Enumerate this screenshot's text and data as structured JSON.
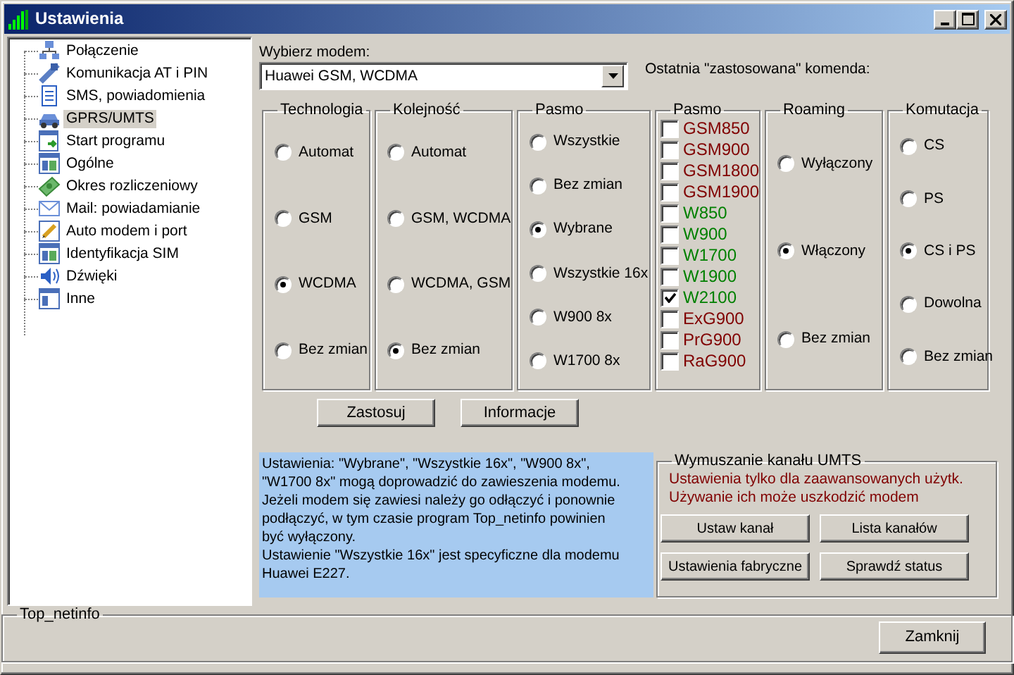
{
  "window": {
    "title": "Ustawienia"
  },
  "sidebar": {
    "items": [
      {
        "label": "Połączenie",
        "selected": false
      },
      {
        "label": "Komunikacja AT i PIN",
        "selected": false
      },
      {
        "label": "SMS, powiadomienia",
        "selected": false
      },
      {
        "label": "GPRS/UMTS",
        "selected": true
      },
      {
        "label": "Start programu",
        "selected": false
      },
      {
        "label": "Ogólne",
        "selected": false
      },
      {
        "label": "Okres rozliczeniowy",
        "selected": false
      },
      {
        "label": "Mail: powiadamianie",
        "selected": false
      },
      {
        "label": "Auto modem i port",
        "selected": false
      },
      {
        "label": "Identyfikacja SIM",
        "selected": false
      },
      {
        "label": "Dźwięki",
        "selected": false
      },
      {
        "label": "Inne",
        "selected": false
      }
    ]
  },
  "modem": {
    "label": "Wybierz modem:",
    "value": "Huawei GSM, WCDMA"
  },
  "last_command": {
    "label": "Ostatnia \"zastosowana\" komenda:"
  },
  "groups": [
    {
      "kind": "radio",
      "title": "Technologia",
      "options": [
        {
          "label": "Automat",
          "selected": false
        },
        {
          "label": "GSM",
          "selected": false
        },
        {
          "label": "WCDMA",
          "selected": true
        },
        {
          "label": "Bez zmian",
          "selected": false
        }
      ]
    },
    {
      "kind": "radio",
      "title": "Kolejność",
      "options": [
        {
          "label": "Automat",
          "selected": false
        },
        {
          "label": "GSM, WCDMA",
          "selected": false
        },
        {
          "label": "WCDMA, GSM",
          "selected": false
        },
        {
          "label": "Bez zmian",
          "selected": true
        }
      ]
    },
    {
      "kind": "radio",
      "title": "Pasmo",
      "options": [
        {
          "label": "Wszystkie",
          "selected": false
        },
        {
          "label": "Bez zmian",
          "selected": false
        },
        {
          "label": "Wybrane",
          "selected": true
        },
        {
          "label": "Wszystkie 16x",
          "selected": false
        },
        {
          "label": "W900 8x",
          "selected": false
        },
        {
          "label": "W1700 8x",
          "selected": false
        }
      ]
    },
    {
      "kind": "checkbox",
      "title": "Pasmo",
      "options": [
        {
          "label": "GSM850",
          "checked": false,
          "color": "#800000"
        },
        {
          "label": "GSM900",
          "checked": false,
          "color": "#800000"
        },
        {
          "label": "GSM1800",
          "checked": false,
          "color": "#800000"
        },
        {
          "label": "GSM1900",
          "checked": false,
          "color": "#800000"
        },
        {
          "label": "W850",
          "checked": false,
          "color": "#008000"
        },
        {
          "label": "W900",
          "checked": false,
          "color": "#008000"
        },
        {
          "label": "W1700",
          "checked": false,
          "color": "#008000"
        },
        {
          "label": "W1900",
          "checked": false,
          "color": "#008000"
        },
        {
          "label": "W2100",
          "checked": true,
          "color": "#008000"
        },
        {
          "label": "ExG900",
          "checked": false,
          "color": "#800000"
        },
        {
          "label": "PrG900",
          "checked": false,
          "color": "#800000"
        },
        {
          "label": "RaG900",
          "checked": false,
          "color": "#800000"
        }
      ]
    },
    {
      "kind": "radio",
      "title": "Roaming",
      "options": [
        {
          "label": "Wyłączony",
          "selected": false
        },
        {
          "label": "Włączony",
          "selected": true
        },
        {
          "label": "Bez zmian",
          "selected": false
        }
      ]
    },
    {
      "kind": "radio",
      "title": "Komutacja",
      "options": [
        {
          "label": "CS",
          "selected": false
        },
        {
          "label": "PS",
          "selected": false
        },
        {
          "label": "CS i PS",
          "selected": true
        },
        {
          "label": "Dowolna",
          "selected": false
        },
        {
          "label": "Bez zmian",
          "selected": false
        }
      ]
    }
  ],
  "actions": [
    "Zastosuj",
    "Informacje"
  ],
  "info_paragraphs": [
    "Ustawienia: \"Wybrane\", \"Wszystkie 16x\", \"W900 8x\",\n\"W1700 8x\" mogą doprowadzić do zawieszenia modemu.\nJeżeli modem się zawiesi należy go odłączyć i ponownie\npodłączyć, w tym czasie program Top_netinfo powinien\nbyć wyłączony.",
    "Ustawienie \"Wszystkie 16x\" jest specyficzne dla modemu\nHuawei E227."
  ],
  "umts": {
    "title": "Wymuszanie kanału UMTS",
    "warning": [
      "Ustawienia tylko dla zaawansowanych użytk.",
      "Używanie ich może uszkodzić modem"
    ],
    "buttons": [
      "Ustaw kanał",
      "Lista kanałów",
      "Ustawienia fabryczne",
      "Sprawdź status"
    ]
  },
  "footer": {
    "title": "Top_netinfo",
    "button": "Zamknij"
  }
}
